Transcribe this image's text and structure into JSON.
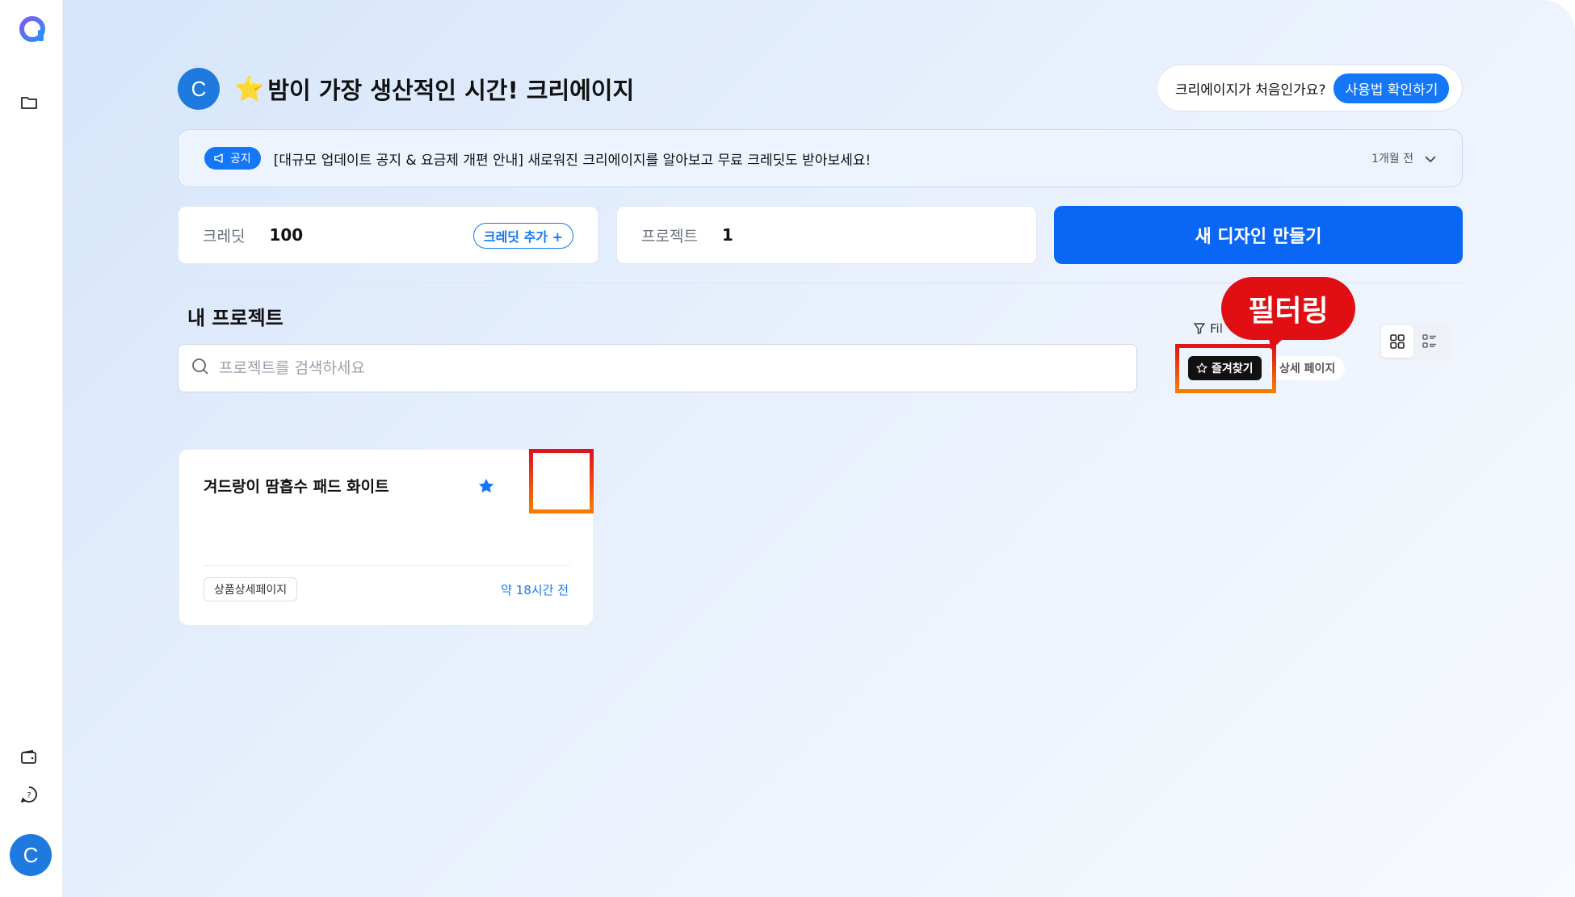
{
  "colors": {
    "brand": "#1477f8",
    "primary_button": "#0a66f5",
    "avatar": "#1f7ae0",
    "callout": "#e10f14",
    "highlight_start": "#e0141c",
    "highlight_end": "#f57c00"
  },
  "sidebar": {
    "logo_icon": "app-logo-icon",
    "items": [
      {
        "icon": "folder-icon"
      },
      {
        "icon": "wallet-icon"
      },
      {
        "icon": "help-chat-icon"
      }
    ],
    "avatar_initial": "C"
  },
  "header": {
    "avatar_initial": "C",
    "greeting_emoji": "⭐",
    "greeting": "밤이 가장 생산적인 시간! 크리에이지",
    "help_question": "크리에이지가 처음인가요?",
    "help_button": "사용법 확인하기"
  },
  "notice": {
    "badge": "공지",
    "text": "[대규모 업데이트 공지 & 요금제 개편 안내] 새로워진 크리에이지를 알아보고 무료 크레딧도 받아보세요!",
    "time": "1개월 전"
  },
  "stats": {
    "credit_label": "크레딧",
    "credit_value": "100",
    "credit_add_button": "크레딧 추가 +",
    "project_label": "프로젝트",
    "project_value": "1"
  },
  "new_design_button": "새 디자인 만들기",
  "projects_section": {
    "title": "내 프로젝트",
    "search_placeholder": "프로젝트를 검색하세요",
    "filter_label": "Fil",
    "chips": {
      "favorites": "즐겨찾기",
      "detail_page": "상세 페이지"
    },
    "callout": "필터링"
  },
  "projects": [
    {
      "title": "겨드랑이 땀흡수 패드 화이트",
      "favorited": true,
      "tag": "상품상세페이지",
      "time": "약 18시간 전"
    }
  ]
}
